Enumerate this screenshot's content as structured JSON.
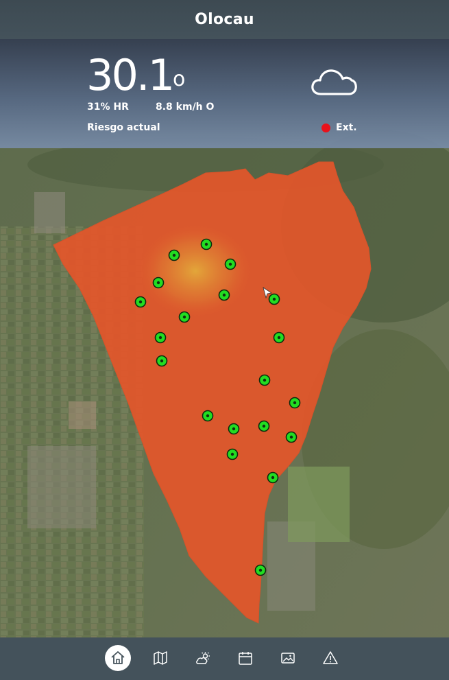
{
  "header": {
    "title": "Olocau"
  },
  "weather": {
    "temperature": "30.1",
    "degree_symbol": "o",
    "humidity": "31% HR",
    "wind": "8.8 km/h O",
    "risk_label": "Riesgo actual",
    "risk_level": "Ext.",
    "risk_color": "#e8121b",
    "condition_icon": "cloud-icon"
  },
  "map": {
    "overlay_color": "#e4562a",
    "station_color": "#22dd22",
    "station_count": 21
  },
  "nav": {
    "items": [
      {
        "name": "home",
        "icon": "home-icon",
        "active": true
      },
      {
        "name": "map",
        "icon": "map-icon",
        "active": false
      },
      {
        "name": "forecast",
        "icon": "weather-icon",
        "active": false
      },
      {
        "name": "calendar",
        "icon": "calendar-icon",
        "active": false
      },
      {
        "name": "gallery",
        "icon": "image-icon",
        "active": false
      },
      {
        "name": "alerts",
        "icon": "warning-icon",
        "active": false
      }
    ]
  }
}
